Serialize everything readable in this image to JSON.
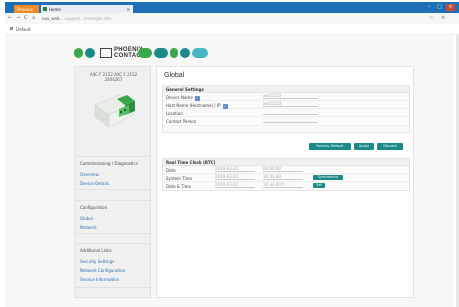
{
  "browser": {
    "tabs": [
      {
        "label": "Phoenix"
      },
      {
        "label": "Home"
      }
    ],
    "url": "nav_web",
    "url_rest": "...support.../example.site",
    "bookmark": "Default"
  },
  "brand": {
    "line1": "PHOENIX",
    "line2": "CONTACT",
    "colors": [
      "#3aa84a",
      "#1a8a88",
      "#47b5c2"
    ]
  },
  "product": {
    "title_line1": "AXC F 2152 AXC F 2152",
    "title_line2": "2404267"
  },
  "sidebar": {
    "sections": [
      {
        "title": "Commissioning / Diagnostics",
        "items": [
          "Overview",
          "Device Details"
        ]
      },
      {
        "title": "Configuration",
        "items": [
          "Global",
          "Network"
        ]
      },
      {
        "title": "Additional Links",
        "items": [
          "Security Settings",
          "Network Configuration",
          "Service Information"
        ]
      }
    ]
  },
  "main": {
    "heading": "Global",
    "general": {
      "header": "General Settings",
      "rows": [
        {
          "label": "Device Name",
          "value": "axcf2152"
        },
        {
          "label": "Host Name (Hostname) / IP",
          "value": "axcf2152"
        },
        {
          "label": "Location",
          "value": ""
        },
        {
          "label": "Contact Person",
          "value": ""
        }
      ]
    },
    "buttons": {
      "factory": "Factory Default",
      "apply": "Apply",
      "discard": "Discard"
    },
    "rtc": {
      "header": "Real Time Clock (RTC)",
      "rows": [
        {
          "label": "Date",
          "c1": "2019-03-22",
          "c2": "00:00:00",
          "action": ""
        },
        {
          "label": "System Time",
          "c1": "2019-03-22",
          "c2": "10:33:40",
          "action": "Synchronize"
        },
        {
          "label": "Date & Time",
          "c1": "2019-03-22",
          "c2": "10:33:40 h",
          "action": "Set"
        }
      ]
    }
  }
}
